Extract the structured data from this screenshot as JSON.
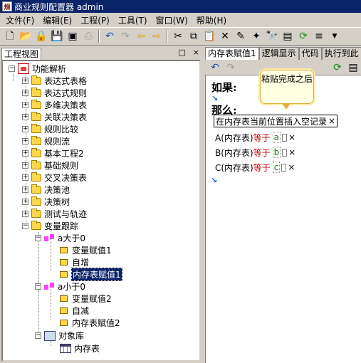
{
  "window": {
    "title": "商业规则配置器 admin"
  },
  "menu": [
    "文件(F)",
    "编辑(E)",
    "工程(P)",
    "工具(T)",
    "窗口(W)",
    "帮助(H)"
  ],
  "toolbar": {
    "icons": [
      "new-icon",
      "open-icon",
      "lock-icon",
      "save-icon",
      "save-all-icon",
      "print-icon",
      "undo-icon",
      "redo-icon",
      "back-icon",
      "forward-icon",
      "cut-icon",
      "copy-icon",
      "paste-icon",
      "delete-icon",
      "edit-icon",
      "wand-icon",
      "find-icon",
      "properties-icon",
      "refresh-icon",
      "format-icon"
    ]
  },
  "left_panel": {
    "title": "工程视图",
    "minimize": "□",
    "close": "×"
  },
  "tree": {
    "root": "功能解析",
    "items": [
      "表达式表格",
      "表达式规则",
      "多维决策表",
      "关联决策表",
      "规则比较",
      "规则流",
      "基本工程2",
      "基础规则",
      "交叉决策表",
      "决策池",
      "决策树",
      "测试与轨迹",
      "变量跟踪"
    ],
    "trace_a_gt": "a大于0",
    "trace_a_gt_children": [
      "变量赋值1",
      "自增",
      "内存表赋值1"
    ],
    "trace_a_lt": "a小于0",
    "trace_a_lt_children": [
      "变量赋值2",
      "自减",
      "内存表赋值2"
    ],
    "object_lib": "对象库",
    "object_lib_children": [
      "内存表"
    ]
  },
  "right_panel": {
    "tabs": [
      "内存表赋值1",
      "逻辑显示",
      "代码",
      "执行到此"
    ],
    "if_label": "如果:",
    "then_label": "那么:",
    "insert_label": "在内存表当前位置插入空记录",
    "rows": [
      {
        "field": "A(内存表)",
        "op": "等于",
        "value": "a"
      },
      {
        "field": "B(内存表)",
        "op": "等于",
        "value": "b"
      },
      {
        "field": "C(内存表)",
        "op": "等于",
        "value": "c"
      }
    ],
    "close_mark": "×"
  },
  "tooltip": {
    "text": "粘贴完成之后"
  }
}
